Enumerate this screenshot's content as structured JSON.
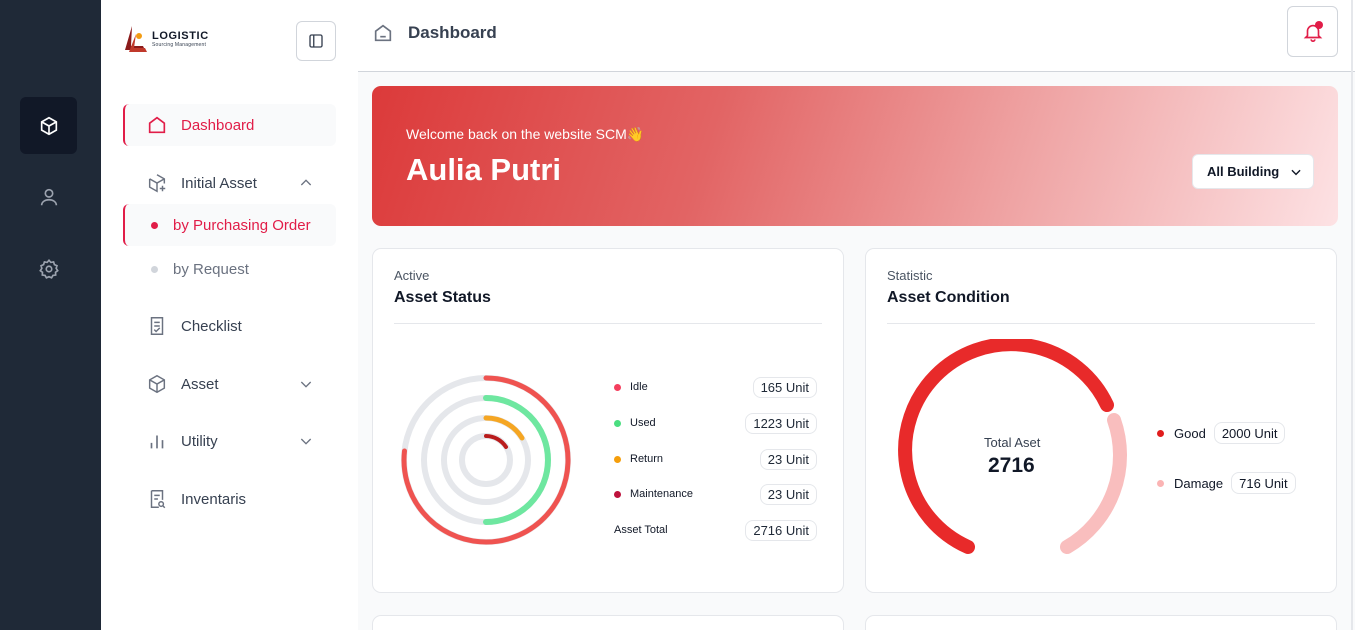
{
  "brand": {
    "name": "LOGISTIC",
    "subtitle": "Sourcing Management"
  },
  "rail": {
    "items": [
      "box-icon",
      "user-icon",
      "settings-icon"
    ]
  },
  "sidebar": {
    "items": [
      {
        "label": "Dashboard",
        "icon": "home-icon",
        "active": true
      },
      {
        "label": "Initial Asset",
        "icon": "box-plus-icon",
        "expanded": true
      },
      {
        "label": "Checklist",
        "icon": "checklist-icon"
      },
      {
        "label": "Asset",
        "icon": "box-icon",
        "expanded": false
      },
      {
        "label": "Utility",
        "icon": "bar-chart-icon",
        "expanded": false
      },
      {
        "label": "Inventaris",
        "icon": "document-search-icon"
      }
    ],
    "subitems": [
      {
        "label": "by Purchasing Order",
        "active": true
      },
      {
        "label": "by Request",
        "active": false
      }
    ]
  },
  "topbar": {
    "title": "Dashboard"
  },
  "hero": {
    "welcome": "Welcome back on the website SCM👋",
    "name": "Aulia Putri",
    "building_select": "All Building"
  },
  "asset_status": {
    "subtitle": "Active",
    "title": "Asset Status",
    "rows": [
      {
        "label": "Idle",
        "value": "165 Unit",
        "color": "#f43f5e"
      },
      {
        "label": "Used",
        "value": "1223 Unit",
        "color": "#4ade80"
      },
      {
        "label": "Return",
        "value": "23 Unit",
        "color": "#f59e0b"
      },
      {
        "label": "Maintenance",
        "value": "23 Unit",
        "color": "#be123c"
      }
    ],
    "total_label": "Asset Total",
    "total_value": "2716 Unit"
  },
  "asset_condition": {
    "subtitle": "Statistic",
    "title": "Asset Condition",
    "center_label": "Total Aset",
    "center_value": "2716",
    "rows": [
      {
        "label": "Good",
        "value": "2000 Unit",
        "color": "#e11d1d"
      },
      {
        "label": "Damage",
        "value": "716 Unit",
        "color": "#fbb4b4"
      }
    ]
  },
  "colors": {
    "accent": "#e11d48",
    "rail_bg": "#1f2937"
  }
}
